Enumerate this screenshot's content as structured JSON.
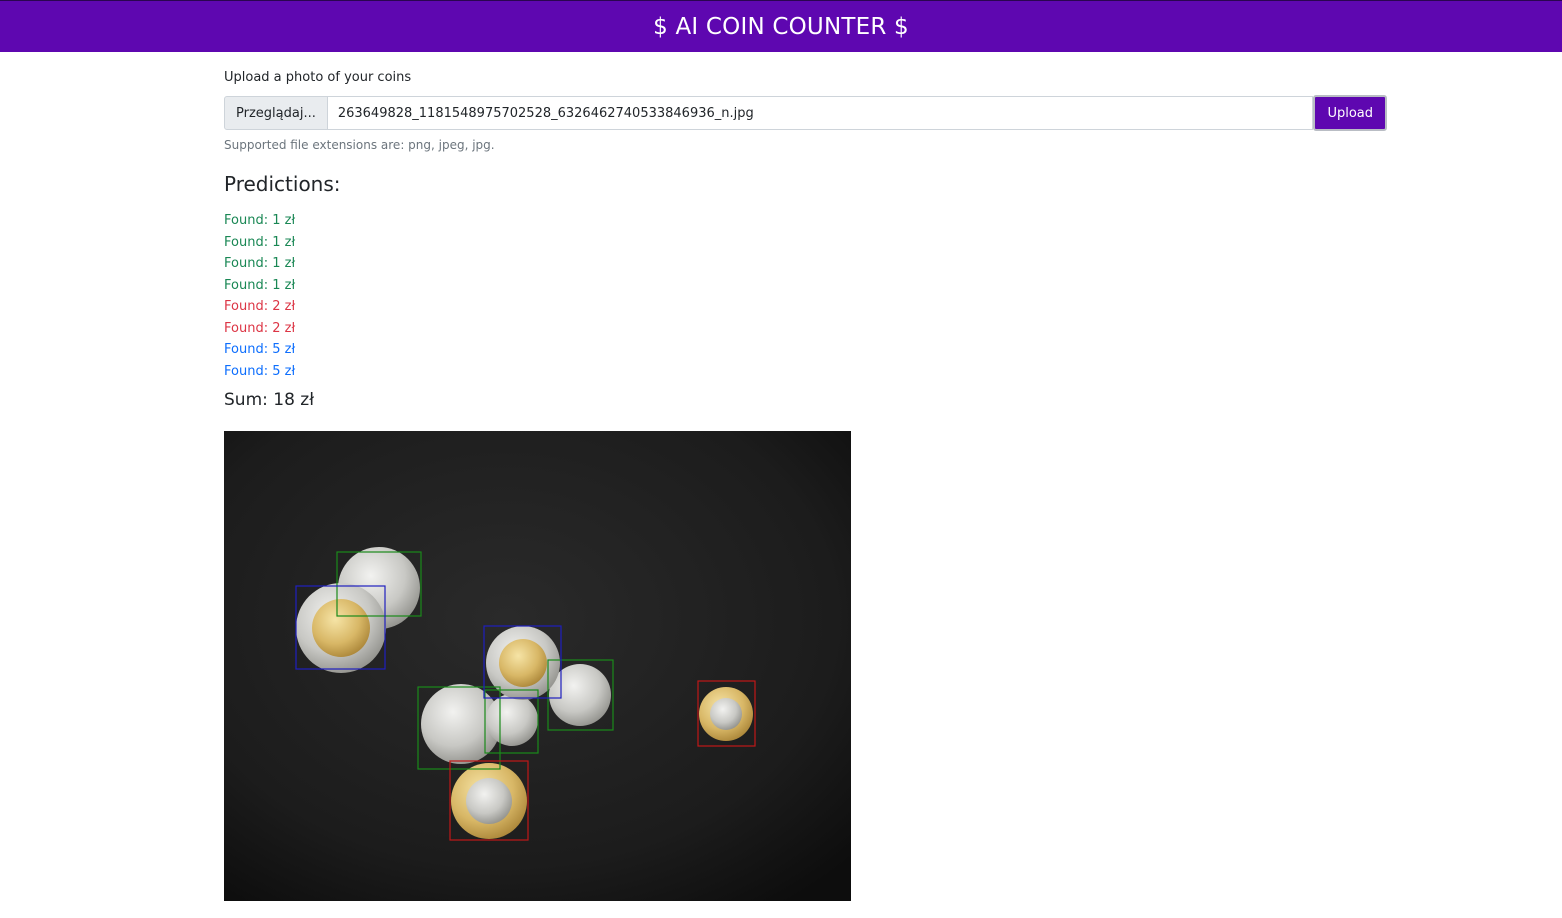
{
  "header": {
    "title": "$ AI COIN COUNTER $"
  },
  "upload": {
    "label": "Upload a photo of your coins",
    "browse_label": "Przeglądaj...",
    "file_name": "263649828_1181548975702528_6326462740533846936_n.jpg",
    "upload_button": "Upload",
    "hint": "Supported file extensions are: png, jpeg, jpg."
  },
  "predictions": {
    "title": "Predictions:",
    "items": [
      {
        "text": "Found: 1 zł",
        "color": "#198754"
      },
      {
        "text": "Found: 1 zł",
        "color": "#198754"
      },
      {
        "text": "Found: 1 zł",
        "color": "#198754"
      },
      {
        "text": "Found: 1 zł",
        "color": "#198754"
      },
      {
        "text": "Found: 2 zł",
        "color": "#dc3545"
      },
      {
        "text": "Found: 2 zł",
        "color": "#dc3545"
      },
      {
        "text": "Found: 5 zł",
        "color": "#0d6efd"
      },
      {
        "text": "Found: 5 zł",
        "color": "#0d6efd"
      }
    ],
    "sum": "Sum: 18 zł"
  },
  "colors": {
    "brand": "#5e07b0",
    "one_zl": "#198754",
    "two_zl": "#dc3545",
    "five_zl": "#0d6efd"
  }
}
